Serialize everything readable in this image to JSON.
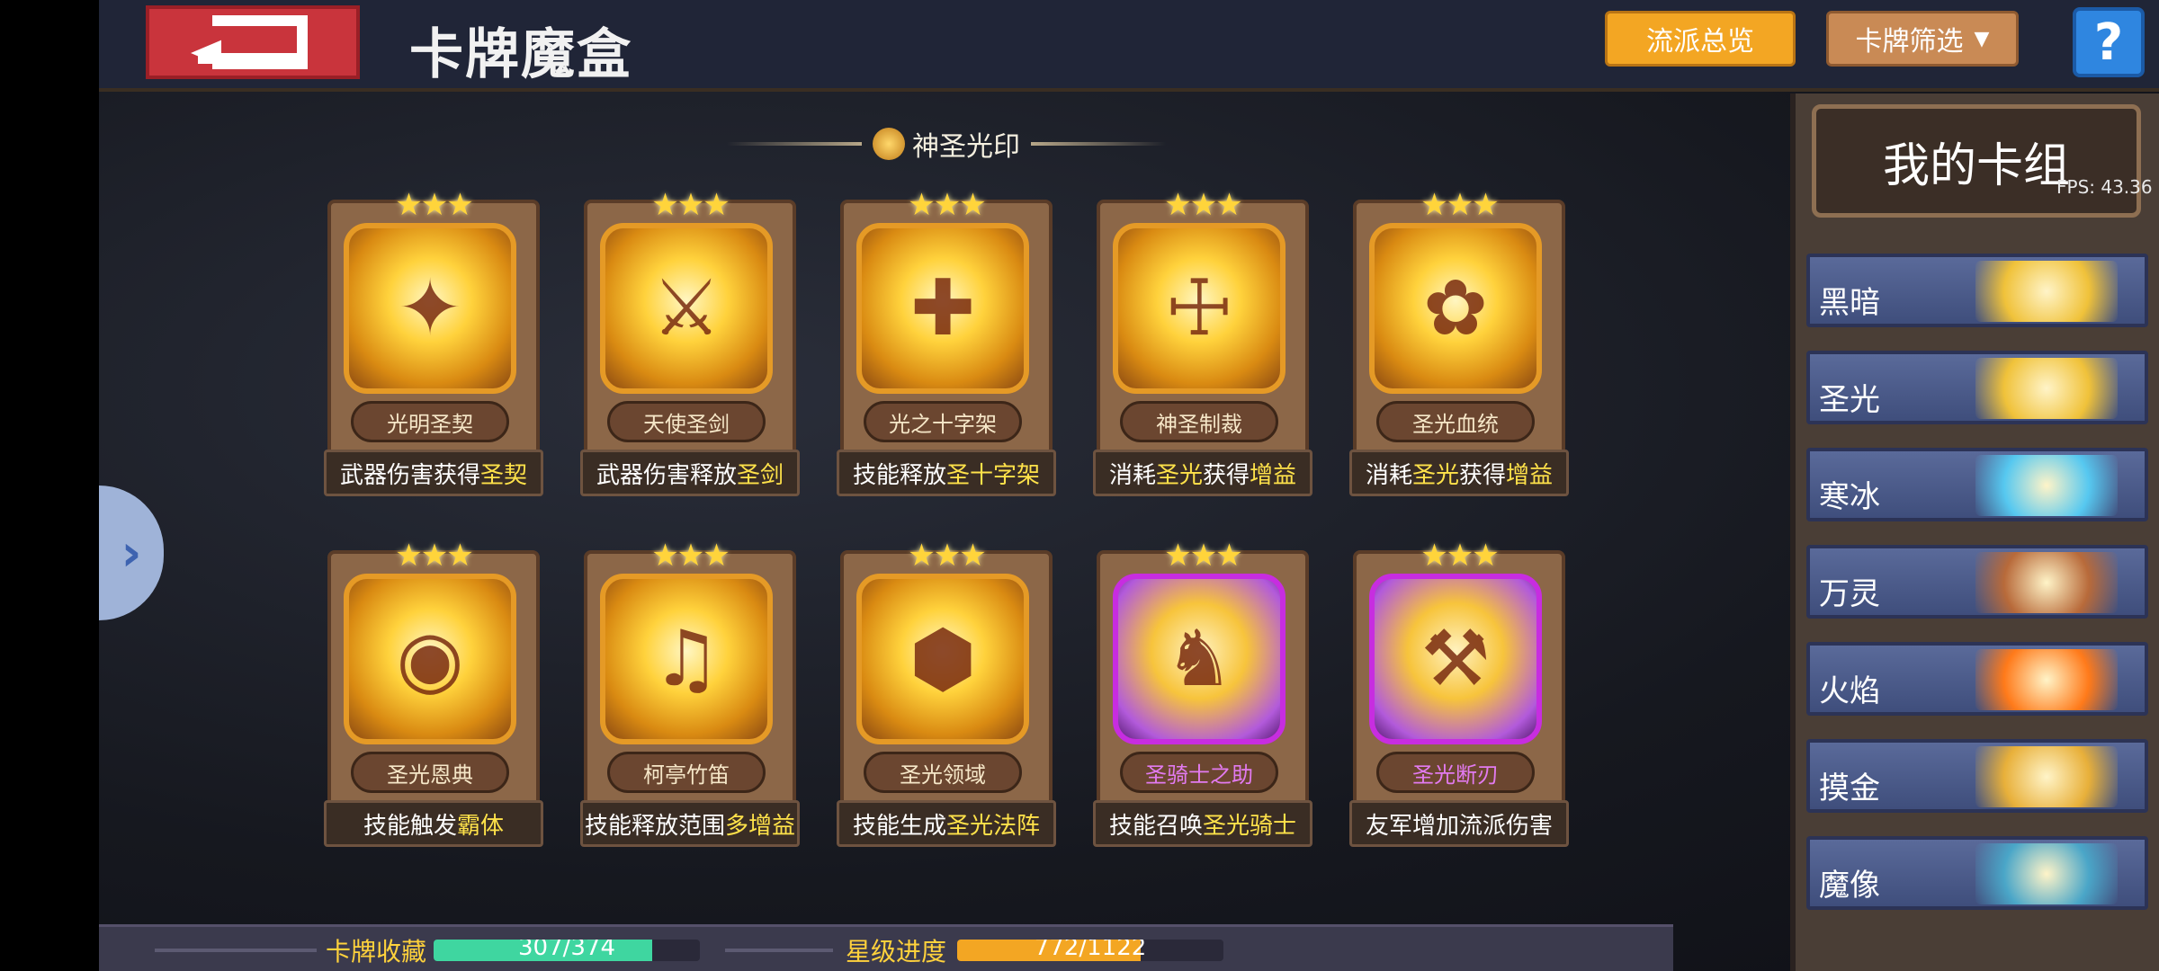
{
  "header": {
    "title": "卡牌魔盒",
    "overview_button": "流派总览",
    "filter_button": "卡牌筛选",
    "help_button": "?"
  },
  "section": {
    "label": "神圣光印"
  },
  "cards": [
    {
      "name": "光明圣契",
      "desc_plain": "武器伤害获得",
      "desc_hl": "圣契",
      "stars": "★★★",
      "frame": "gold"
    },
    {
      "name": "天使圣剑",
      "desc_plain": "武器伤害释放",
      "desc_hl": "圣剑",
      "stars": "★★★",
      "frame": "gold"
    },
    {
      "name": "光之十字架",
      "desc_plain": "技能释放",
      "desc_hl": "圣十字架",
      "stars": "★★★",
      "frame": "gold"
    },
    {
      "name": "神圣制裁",
      "desc_plain": "消耗",
      "desc_hl": "圣光",
      "desc_plain2": "获得",
      "desc_hl2": "增益",
      "stars": "★★★",
      "frame": "gold"
    },
    {
      "name": "圣光血统",
      "desc_plain": "消耗",
      "desc_hl": "圣光",
      "desc_plain2": "获得",
      "desc_hl2": "增益",
      "stars": "★★★",
      "frame": "gold"
    },
    {
      "name": "圣光恩典",
      "desc_plain": "技能触发",
      "desc_hl": "霸体",
      "stars": "★★★",
      "frame": "gold"
    },
    {
      "name": "柯亭竹笛",
      "desc_plain": "技能释放范围",
      "desc_hl": "多增益",
      "stars": "★★★",
      "frame": "gold"
    },
    {
      "name": "圣光领域",
      "desc_plain": "技能生成",
      "desc_hl": "圣光法阵",
      "stars": "★★★",
      "frame": "gold"
    },
    {
      "name": "圣骑士之助",
      "desc_plain": "技能召唤",
      "desc_hl": "圣光骑士",
      "stars": "★★★",
      "frame": "purple"
    },
    {
      "name": "圣光断刃",
      "desc_plain": "友军增加流派伤害",
      "desc_hl": "",
      "stars": "★★★",
      "frame": "purple"
    }
  ],
  "progress": {
    "collection_label": "卡牌收藏",
    "collection_text": "307/374",
    "collection_fraction": 0.8209,
    "star_label": "星级进度",
    "star_text": "772/1122",
    "star_fraction": 0.688
  },
  "deck": {
    "title": "我的卡组",
    "fps": "FPS: 43.36",
    "items": [
      {
        "label": "黑暗",
        "color": "#f0c23a"
      },
      {
        "label": "圣光",
        "color": "#f0c23a"
      },
      {
        "label": "寒冰",
        "color": "#56c8f0"
      },
      {
        "label": "万灵",
        "color": "#b86a3a"
      },
      {
        "label": "火焰",
        "color": "#ff7a1a"
      },
      {
        "label": "摸金",
        "color": "#e8b03a"
      },
      {
        "label": "魔像",
        "color": "#4aa6c8"
      }
    ]
  },
  "colors": {
    "accent_orange": "#f3a623",
    "highlight_yellow": "#ffe24a",
    "collection_bar": "#3fd6a0",
    "star_bar": "#f3a623"
  }
}
